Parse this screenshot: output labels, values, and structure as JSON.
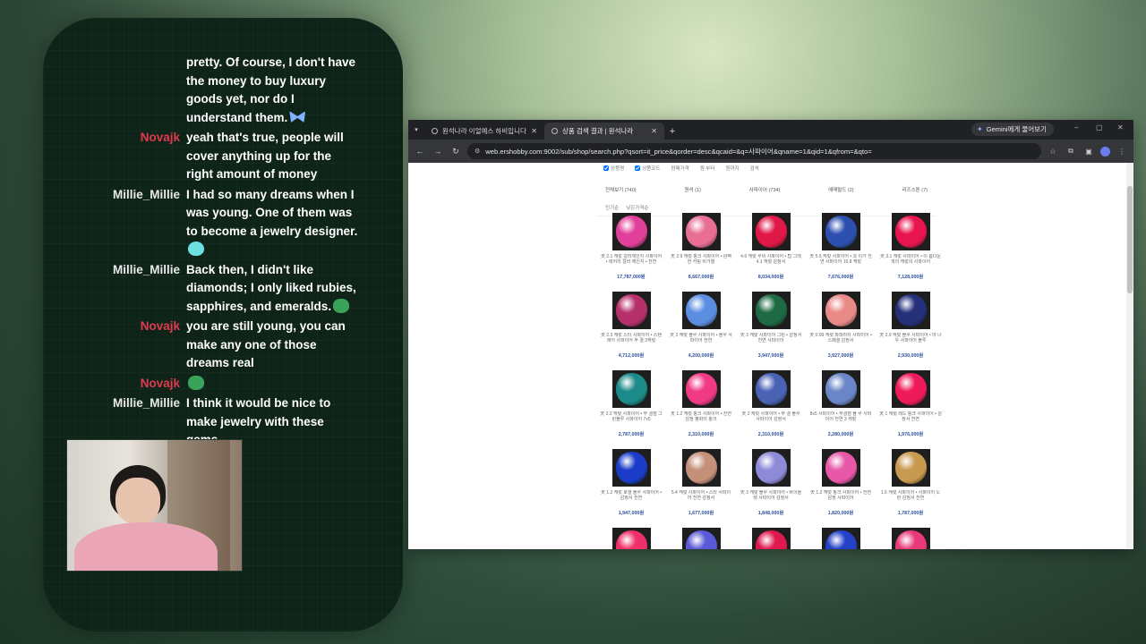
{
  "chat": {
    "messages": [
      {
        "user": "",
        "text": "pretty. Of course, I don't have the money to buy luxury goods yet, nor do I understand them.",
        "emote": "butterfly-emote"
      },
      {
        "user": "Novajk",
        "text": "yeah that's true, people will cover anything up for the right amount of money",
        "emote": ""
      },
      {
        "user": "Millie_Millie",
        "text": "I had so many dreams when I was young. One of them was to become a jewelry designer.",
        "emote": "cat-emote"
      },
      {
        "user": "Millie_Millie",
        "text": "Back then, I didn't like diamonds; I only liked rubies, sapphires, and emeralds.",
        "emote": "frog-emote"
      },
      {
        "user": "Novajk",
        "text": "you are still young, you can make any one of those dreams real",
        "emote": ""
      },
      {
        "user": "Novajk",
        "text": "",
        "emote": "frog-emote"
      },
      {
        "user": "Millie_Millie",
        "text": "I think it would be nice to make jewelry with these gems.",
        "emote": ""
      }
    ],
    "colors": {
      "novajk": "#e03a4e",
      "millie": "#e8e8e8"
    }
  },
  "browser": {
    "tabs": [
      {
        "title": "원석나라 이얼예스 하비입니다",
        "active": false
      },
      {
        "title": "상품 검색 결과 | 원석나라",
        "active": true
      }
    ],
    "new_tab": "+",
    "gemini": "Gemini에게 물어보기",
    "url": "web.ershobby.com:9002/sub/shop/search.php?qsort=it_price&qorder=desc&qcaid=&q=사파이어&qname=1&qid=1&qfrom=&qto=",
    "window_controls": {
      "minimize": "–",
      "maximize": "▢",
      "close": "✕"
    },
    "nav": {
      "back": "←",
      "forward": "→",
      "reload": "↻"
    }
  },
  "filters": {
    "checks": [
      "상품명",
      "상품코드",
      "판매가격",
      "원 부터",
      "원까지",
      "검색"
    ],
    "categories": [
      "전체보기 (740)",
      "원석 (1)",
      "사파이어 (734)",
      "에메랄드 (2)",
      "리즈스톤 (7)"
    ],
    "sorts": [
      "인기순",
      "낮은가격순"
    ]
  },
  "products": [
    [
      {
        "name": "天 2.1 캐럿 컬러체인지 사파이어 • 레어리 컬러 체인지 • 천연",
        "price": "17,787,000원",
        "color": "#e0409a"
      },
      {
        "name": "天 2.9 캐럿 핑크 사파이어 • 완벽한 커팅 비가열",
        "price": "8,667,000원",
        "color": "#e86e94"
      },
      {
        "name": "4.6 캐럿 루비 사파이어 • 탑 그레 4.1 캐럿 감정서",
        "price": "8,034,000원",
        "color": "#e01848"
      },
      {
        "name": "天 5.5 캐럿 사파이어 • 코 이가 천연 사파이어 10.8 캐럿",
        "price": "7,676,000원",
        "color": "#2d4fb0"
      },
      {
        "name": "天 3.1 캐럿 사파이어 • 이 름다운 색의 캐럿의 사파이어",
        "price": "7,128,000원",
        "color": "#e8144e"
      }
    ],
    [
      {
        "name": "天 2.3 캐럿 스타 사파이어 • 스탠 레어 사파이어 무 결 3캐럿",
        "price": "4,712,000원",
        "color": "#b6306a"
      },
      {
        "name": "天 3 캐럿 블루 사파이어 • 블루 사파이어 천연",
        "price": "4,200,000원",
        "color": "#5b8ee0"
      },
      {
        "name": "天 3 캐럿 사파이어 그린 • 감정서 천연 사파이어",
        "price": "3,947,000원",
        "color": "#1d6a44"
      },
      {
        "name": "天 0.99 캐럿 파파라차 사파이어 • 스페셜 감정서",
        "price": "3,927,000원",
        "color": "#e88a86"
      },
      {
        "name": "天 2.9 캐럿 블루 사파이어 • 마 너우 사파이어 블루",
        "price": "2,930,000원",
        "color": "#24307a"
      }
    ],
    [
      {
        "name": "天 2.2 캐럿 사파이어 • 무 결점 그린블루 사파이어 7x5",
        "price": "2,787,000원",
        "color": "#1b8a88"
      },
      {
        "name": "天 1.2 캐럿 핑크 사파이어 • 천연 감정 평화의 핑크",
        "price": "2,310,000원",
        "color": "#f03a84"
      },
      {
        "name": "天 2 캐럿 사파이어 • 무 결 블루 사파이어 감정서",
        "price": "2,310,000원",
        "color": "#4a62b4"
      },
      {
        "name": "8x5 사파이어 • 무결점 블 루 사파이어 천연 3 캐럿",
        "price": "2,280,000원",
        "color": "#6a86c8"
      },
      {
        "name": "天 1 캐럿 레드 핑크 사파이어 • 감정서 천연",
        "price": "1,976,000원",
        "color": "#ef1a5a"
      }
    ],
    [
      {
        "name": "天 1.2 캐럿 로열 블루 사파이어 • 감정서 천연",
        "price": "1,947,000원",
        "color": "#1a3cc8"
      },
      {
        "name": "5.4 캐럿 사파이어 • 스타 사파이어 천연 감정서",
        "price": "1,677,000원",
        "color": "#c4907a"
      },
      {
        "name": "天 3 캐럿 블루 사파이어 • 바이올렛 사파이어 감정서",
        "price": "1,848,000원",
        "color": "#8d8ad8"
      },
      {
        "name": "天 1.2 캐럿 핑크 사파이어 • 천연 감정 사파이어",
        "price": "1,820,000원",
        "color": "#e858a8"
      },
      {
        "name": "1.6 캐럿 사파이어 • 사파이어 노란 감정서 천연",
        "price": "1,787,000원",
        "color": "#c89a50"
      }
    ],
    [
      {
        "name": "",
        "price": "",
        "color": "#f0306a"
      },
      {
        "name": "",
        "price": "",
        "color": "#5a5ad8"
      },
      {
        "name": "",
        "price": "",
        "color": "#e01850"
      },
      {
        "name": "",
        "price": "",
        "color": "#2440c8"
      },
      {
        "name": "",
        "price": "",
        "color": "#e83a7a"
      }
    ]
  ]
}
